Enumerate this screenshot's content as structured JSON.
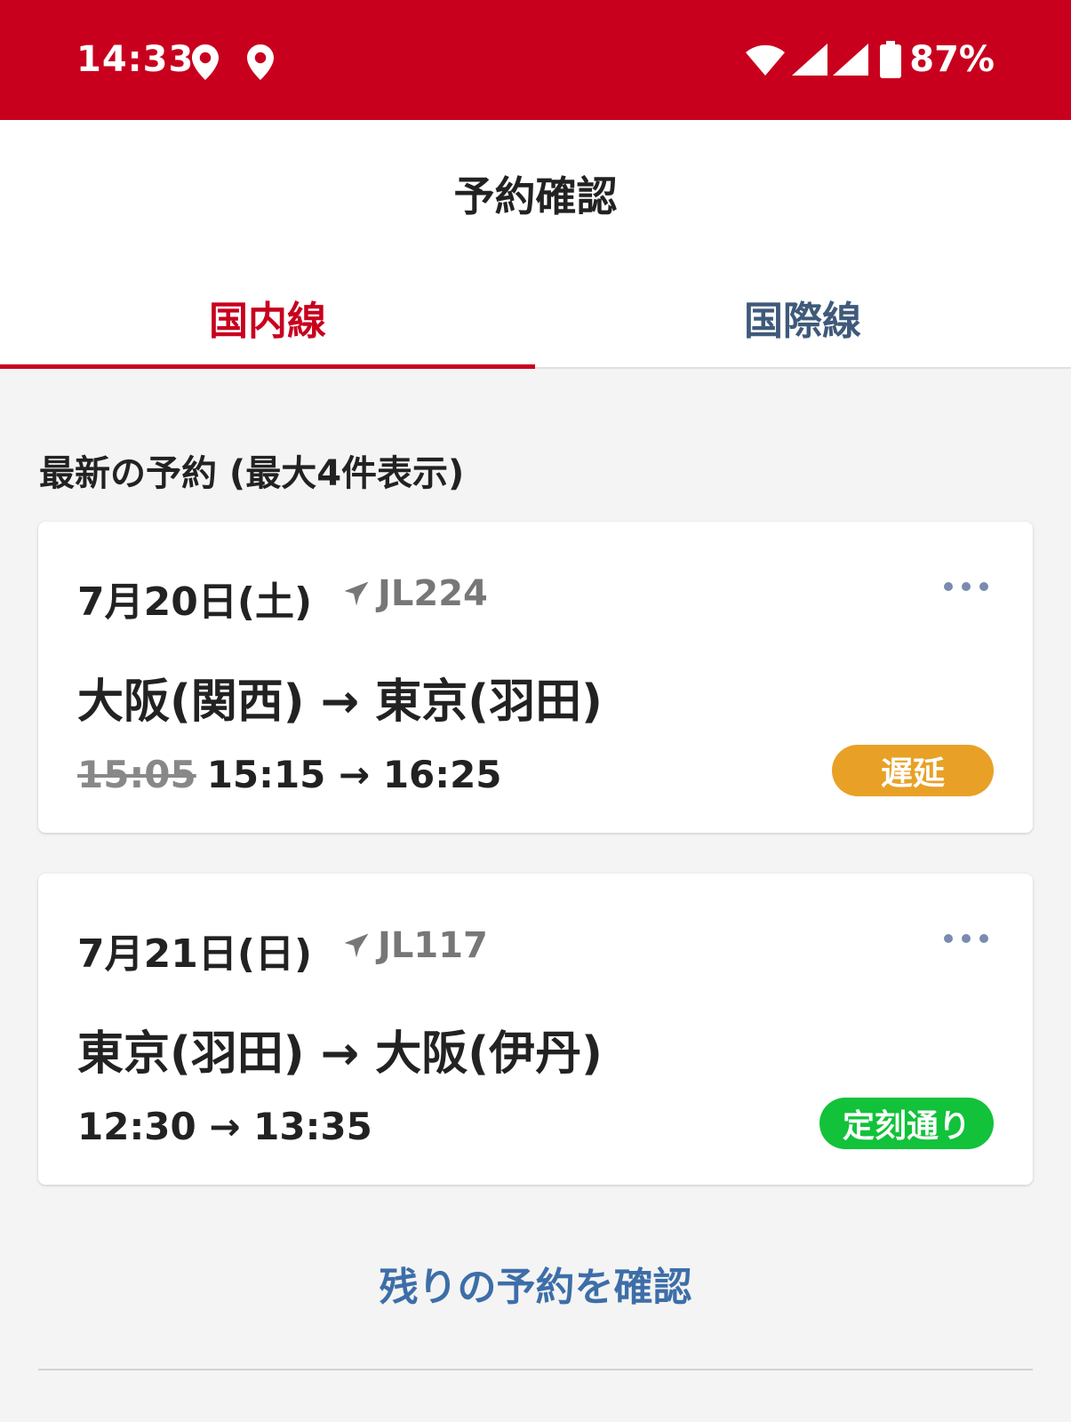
{
  "status_bar": {
    "time": "14:33",
    "icons": [
      "location-icon",
      "location-icon",
      "wifi-icon",
      "signal-icon",
      "signal-icon",
      "battery-icon"
    ],
    "battery": "87%",
    "color": "#c8001e"
  },
  "header": {
    "title": "予約確認",
    "tabs": [
      {
        "label": "国内線",
        "active": true
      },
      {
        "label": "国際線",
        "active": false
      }
    ]
  },
  "section": {
    "label": "最新の予約 (最大4件表示)"
  },
  "reservations": [
    {
      "date": "7月20日(土)",
      "flight": "JL224",
      "route": "大阪(関西) → 東京(羽田)",
      "old_departure": "15:05",
      "times": "15:15 → 16:25",
      "status": "遅延",
      "status_color": "#e8a126"
    },
    {
      "date": "7月21日(日)",
      "flight": "JL117",
      "route": "東京(羽田) → 大阪(伊丹)",
      "times": "12:30 → 13:35",
      "status": "定刻通り",
      "status_color": "#12c23a"
    }
  ],
  "more_link": "残りの予約を確認"
}
